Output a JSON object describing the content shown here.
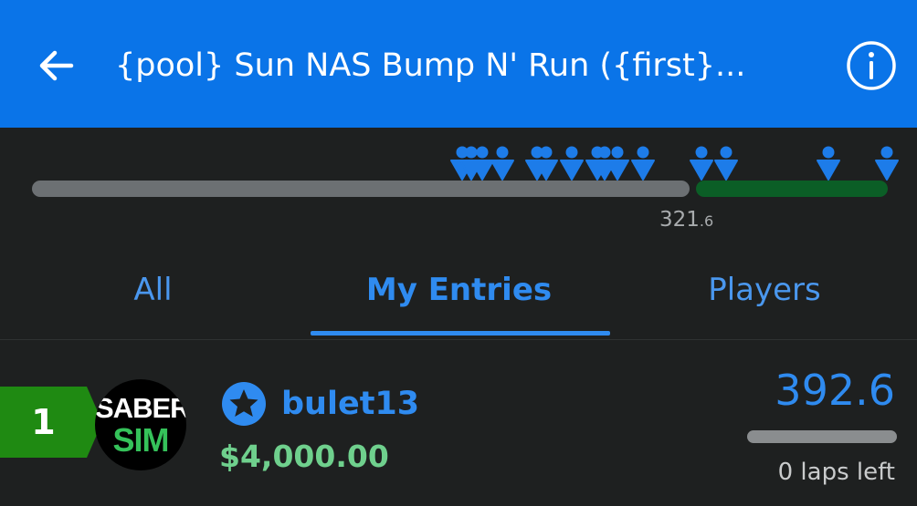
{
  "header": {
    "title": "{pool} Sun NAS Bump N' Run ({first}...",
    "back_icon": "arrow-left-icon",
    "info_icon": "info-circle-icon",
    "background_color": "#0a74e8"
  },
  "progress": {
    "marker_value_main": "321",
    "marker_value_decimal": ".6",
    "completed_fraction": 0.77,
    "player_icon": "person-marker-icon",
    "colors": {
      "track": "#6c7073",
      "remaining": "#0b5e26",
      "marker": "#1d7ce9"
    }
  },
  "tabs": [
    {
      "label": "All",
      "active": false
    },
    {
      "label": "My Entries",
      "active": true
    },
    {
      "label": "Players",
      "active": false
    }
  ],
  "entry": {
    "rank": "1",
    "avatar_line1": "SABER",
    "avatar_line2": "SIM",
    "username": "bulet13",
    "prize": "$4,000.00",
    "score": "392.6",
    "laps_left": "0 laps left",
    "star_icon": "star-badge-icon",
    "rank_color": "#1f8a12"
  }
}
